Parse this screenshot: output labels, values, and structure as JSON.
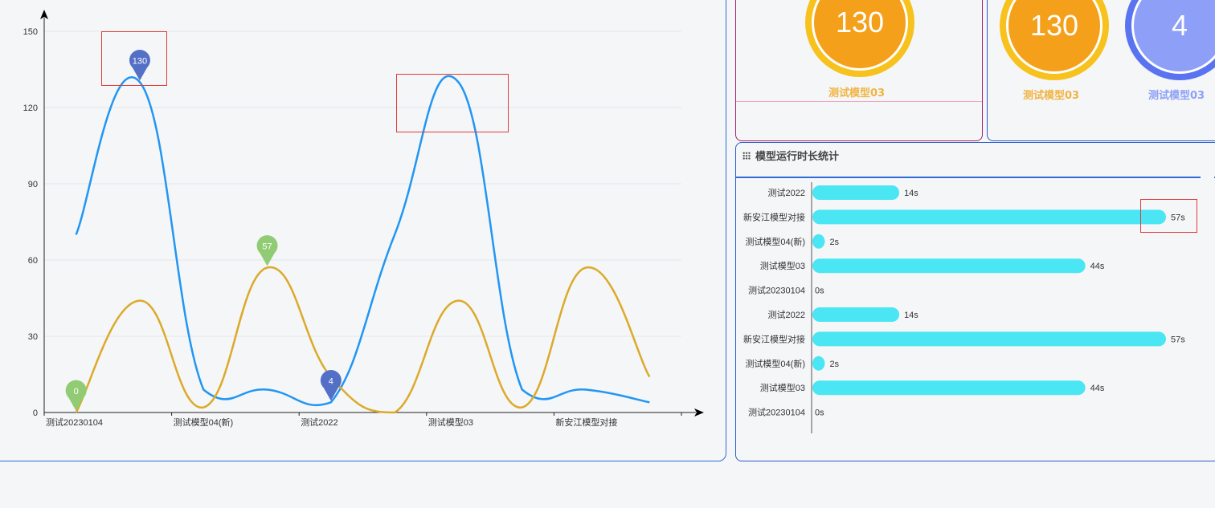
{
  "line_chart": {
    "chart_data": {
      "type": "line",
      "categories": [
        "测试20230104",
        "测试模型03",
        "测试模型04(新)",
        "新安江模型对接",
        "测试2022",
        "测试20230104",
        "测试模型03",
        "测试模型04(新)",
        "新安江模型对接",
        "测试2022"
      ],
      "x_tick_labels": [
        "测试20230104",
        "测试模型04(新)",
        "测试2022",
        "测试模型03",
        "新安江模型对接"
      ],
      "series": [
        {
          "values": [
            70,
            130,
            9,
            9,
            4,
            70,
            130,
            9,
            9,
            4
          ],
          "color": "#2196f3"
        },
        {
          "values": [
            0,
            44,
            2,
            57,
            14,
            0,
            44,
            2,
            57,
            14
          ],
          "color": "#dcaa2a"
        }
      ],
      "ylim": [
        0,
        150
      ],
      "yticks": [
        0,
        30,
        60,
        90,
        120,
        150
      ],
      "markers": [
        {
          "label": "130",
          "series": 0,
          "index": 1,
          "color": "#5470c6"
        },
        {
          "label": "4",
          "series": 0,
          "index": 4,
          "color": "#5470c6"
        },
        {
          "label": "57",
          "series": 1,
          "index": 3,
          "color": "#91cc75"
        },
        {
          "label": "0",
          "series": 1,
          "index": 0,
          "color": "#91cc75"
        }
      ],
      "grid": true
    }
  },
  "gauges": [
    {
      "value": "130",
      "label": "测试模型03",
      "color": "orange"
    },
    {
      "value": "130",
      "label": "测试模型03",
      "color": "orange"
    },
    {
      "value": "4",
      "label": "测试模型03",
      "color": "blue"
    }
  ],
  "duration_panel": {
    "title": "模型运行时长统计",
    "icon": "grid-dots-icon",
    "chart_data": {
      "type": "bar",
      "orientation": "horizontal",
      "categories": [
        "测试2022",
        "新安江模型对接",
        "测试模型04(新)",
        "测试模型03",
        "测试20230104",
        "测试2022",
        "新安江模型对接",
        "测试模型04(新)",
        "测试模型03",
        "测试20230104"
      ],
      "values": [
        14,
        57,
        2,
        44,
        0,
        14,
        57,
        2,
        44,
        0
      ],
      "value_labels": [
        "14s",
        "57s",
        "2s",
        "44s",
        "0s",
        "14s",
        "57s",
        "2s",
        "44s",
        "0s"
      ],
      "xlim": [
        0,
        57
      ],
      "color": "#4ae6f3"
    }
  }
}
